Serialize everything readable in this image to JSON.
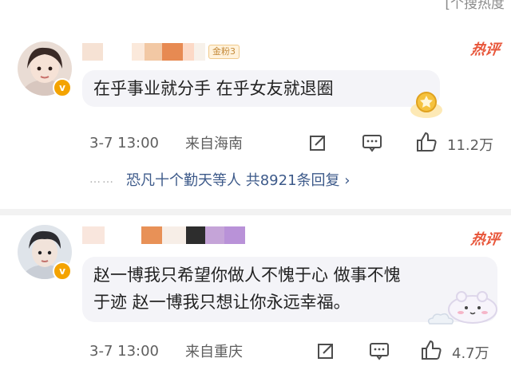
{
  "top_cut_text": "[个搜热度",
  "comments": [
    {
      "fans_badge": "金粉3",
      "hot_label": "热评",
      "text": "在乎事业就分手 在乎女友就退圈",
      "time": "3-7 13:00",
      "source": "来自海南",
      "likes": "11.2万",
      "replies_text": "恐凡十个勤天等人 共8921条回复 ›"
    },
    {
      "hot_label": "热评",
      "text_line1": "赵一博我只希望你做人不愧于心 做事不愧",
      "text_line2": "于迹 赵一博我只想让你永远幸福。",
      "time": "3-7 13:00",
      "source": "来自重庆",
      "likes": "4.7万"
    }
  ],
  "icons": [
    "share-icon",
    "comment-icon",
    "like-icon",
    "verified-badge-icon"
  ],
  "colors": {
    "hot": "#e8563a",
    "link": "#3d5a8a",
    "badge": "#f4a300"
  }
}
